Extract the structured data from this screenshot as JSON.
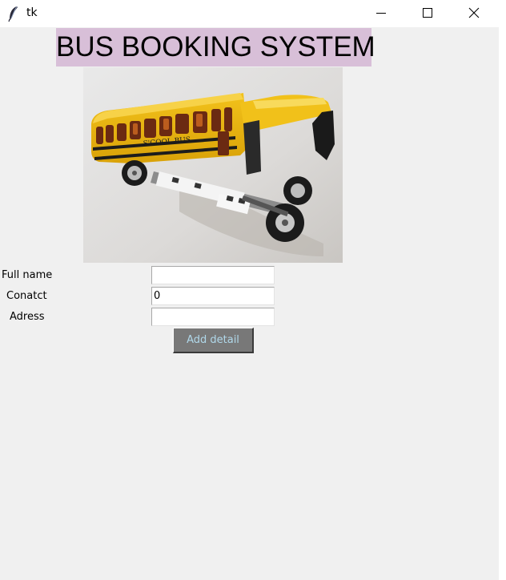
{
  "window": {
    "title": "tk",
    "controls": {
      "minimize": "minimize-icon",
      "maximize": "maximize-icon",
      "close": "close-icon"
    }
  },
  "header": {
    "title": "BUS BOOKING SYSTEM",
    "background_color": "#d8bfd8"
  },
  "image": {
    "subject": "yellow toy school bus doing a wheelie",
    "text_on_image": "S'COOL BUS"
  },
  "form": {
    "fields": [
      {
        "label": "Full name",
        "value": ""
      },
      {
        "label": "Conatct",
        "value": "0"
      },
      {
        "label": "Adress",
        "value": ""
      }
    ],
    "submit_label": "Add detail",
    "submit_color": "#787878",
    "submit_text_color": "#b0d8ea"
  }
}
